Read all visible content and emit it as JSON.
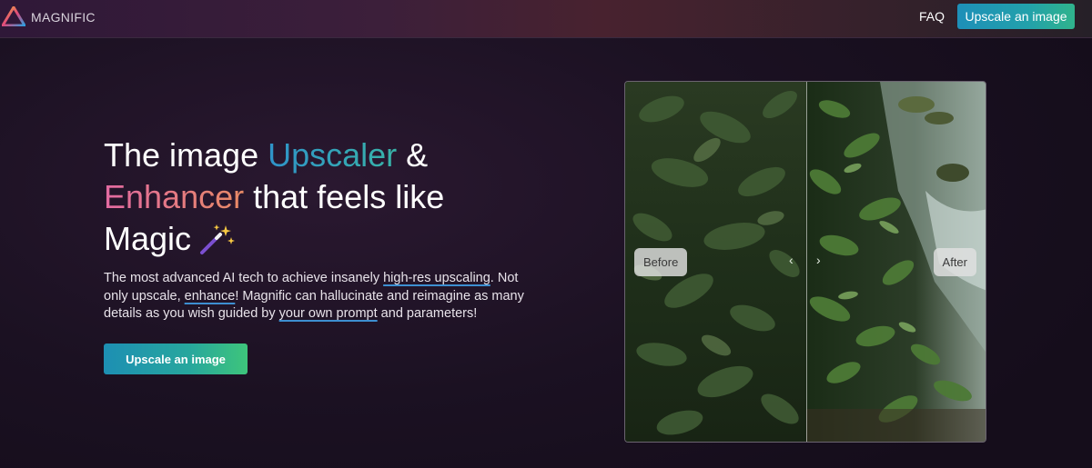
{
  "nav": {
    "brand": "MAGNIFIC",
    "faq": "FAQ",
    "cta": "Upscale an image"
  },
  "hero": {
    "headline": {
      "part1": "The image ",
      "highlight1": "Upscaler",
      "part2": " &",
      "highlight2": "Enhancer",
      "part3": " that feels like",
      "part4": "Magic",
      "emoji": "magic-wand-icon"
    },
    "description": {
      "t1": "The most advanced AI tech to achieve insanely ",
      "link1": "high-res upscaling",
      "t2": ". Not only upscale, ",
      "link2": "enhance",
      "t3": "! Magnific can hallucinate and reimagine as many details as you wish guided by ",
      "link3": "your own prompt",
      "t4": " and parameters!"
    },
    "cta": "Upscale an image"
  },
  "compare": {
    "before_label": "Before",
    "after_label": "After",
    "left_arrow": "‹",
    "right_arrow": "›"
  },
  "colors": {
    "accent_blue": "#2f93c9",
    "accent_teal": "#30b38c",
    "accent_pink": "#e26aa2",
    "background": "#1a1121"
  }
}
